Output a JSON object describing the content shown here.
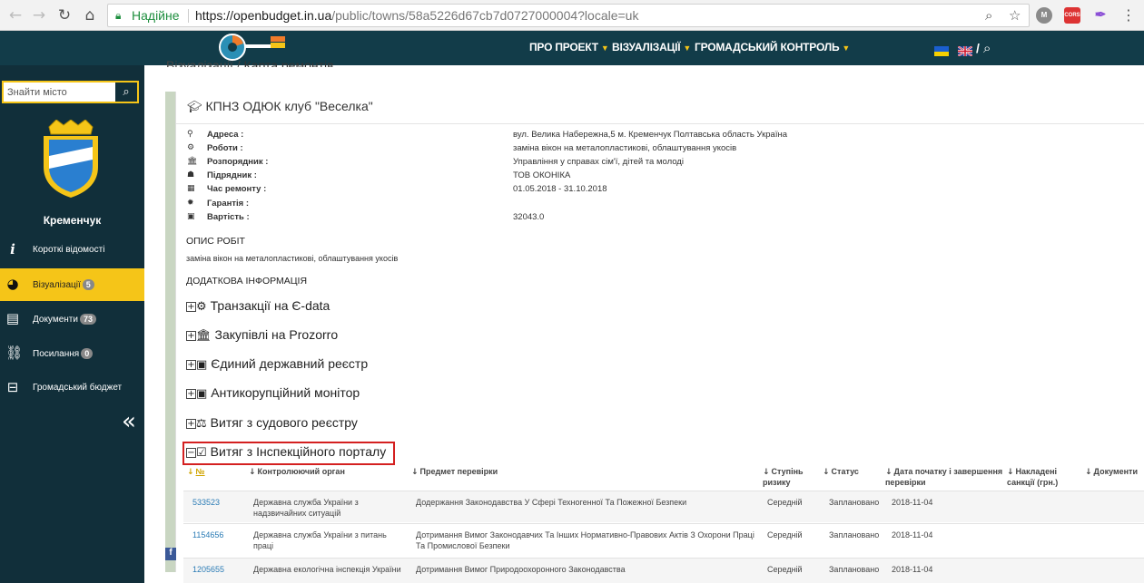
{
  "browser": {
    "secure_label": "Надійне",
    "url_host": "https://openbudget.in.ua",
    "url_path": "/public/towns/58a5226d67cb7d0727000004?locale=uk",
    "extensions": [
      "M",
      "CORS"
    ]
  },
  "topnav": {
    "items": [
      {
        "label": "ПРО ПРОЕКТ"
      },
      {
        "label": "ВІЗУАЛІЗАЦІЇ"
      },
      {
        "label": "ГРОМАДСЬКИЙ КОНТРОЛЬ"
      }
    ],
    "lang_separator": "/"
  },
  "sidebar": {
    "search_placeholder": "Знайти місто",
    "city_name": "Кременчук",
    "items": [
      {
        "label": "Короткі відомості",
        "badge": null,
        "icon": "info-icon"
      },
      {
        "label": "Візуалізації",
        "badge": "5",
        "icon": "pie-chart-icon"
      },
      {
        "label": "Документи",
        "badge": "73",
        "icon": "document-icon"
      },
      {
        "label": "Посилання",
        "badge": "0",
        "icon": "link-icon"
      },
      {
        "label": "Громадський бюджет",
        "badge": null,
        "icon": "ballot-box-icon"
      }
    ]
  },
  "breadcrumb": {
    "prefix": "Візуалізації",
    "sep": " / ",
    "current": "Карта ремонтів"
  },
  "object": {
    "title": "КПНЗ ОДЮК клуб \"Веселка\"",
    "fields": [
      {
        "icon": "map-marker-icon",
        "label": "Адреса :",
        "value": "вул. Велика Набережна,5 м. Кременчук Полтавська область Україна"
      },
      {
        "icon": "cogs-icon",
        "label": "Роботи :",
        "value": "заміна вікон на металопластикові, облаштування укосів"
      },
      {
        "icon": "institution-icon",
        "label": "Розпорядник :",
        "value": "Управління у справах сім'ї, дітей та молоді"
      },
      {
        "icon": "worker-icon",
        "label": "Підрядник :",
        "value": "ТОВ ОКОНІКА"
      },
      {
        "icon": "calendar-icon",
        "label": "Час ремонту :",
        "value": "01.05.2018 - 31.10.2018"
      },
      {
        "icon": "certificate-icon",
        "label": "Гарантія :",
        "value": ""
      },
      {
        "icon": "money-icon",
        "label": "Вартість :",
        "value": "32043.0"
      }
    ],
    "work_desc_heading": "ОПИС РОБІТ",
    "work_desc_text": "заміна вікон на металопластикові, облаштування укосів",
    "extra_heading": "ДОДАТКОВА ІНФОРМАЦІЯ"
  },
  "accordion": [
    {
      "label": "Транзакції на Є-data",
      "state": "+",
      "icon": "cogs-icon"
    },
    {
      "label": "Закупівлі на Prozorro",
      "state": "+",
      "icon": "institution-icon"
    },
    {
      "label": "Єдиний державний реєстр",
      "state": "+",
      "icon": "money-icon"
    },
    {
      "label": "Антикорупційний монітор",
      "state": "+",
      "icon": "money-icon"
    },
    {
      "label": "Витяг з судового реєстру",
      "state": "+",
      "icon": "scales-icon"
    },
    {
      "label": "Витяг з Інспекційного порталу",
      "state": "−",
      "icon": "calendar-check-icon"
    }
  ],
  "table": {
    "columns": [
      "№",
      "Контролюючий орган",
      "Предмет перевірки",
      "Ступінь ризику",
      "Статус",
      "Дата початку і завершення перевірки",
      "Накладені санкції (грн.)",
      "Документи"
    ],
    "rows": [
      {
        "num": "533523",
        "organ": "Державна служба України з надзвичайних ситуацій",
        "subject": "Додержання Законодавства У Сфері Техногенної Та Пожежної Безпеки",
        "risk": "Середній",
        "status": "Заплановано",
        "date": "2018-11-04"
      },
      {
        "num": "1154656",
        "organ": "Державна служба України з питань праці",
        "subject": "Дотримання Вимог Законодавчих Та Інших Нормативно-Правових Актів З Охорони Праці Та Промислової Безпеки",
        "risk": "Середній",
        "status": "Заплановано",
        "date": "2018-11-04"
      },
      {
        "num": "1205655",
        "organ": "Державна екологічна інспекція України",
        "subject": "Дотримання Вимог Природоохоронного Законодавства",
        "risk": "Середній",
        "status": "Заплановано",
        "date": "2018-11-04"
      }
    ]
  }
}
